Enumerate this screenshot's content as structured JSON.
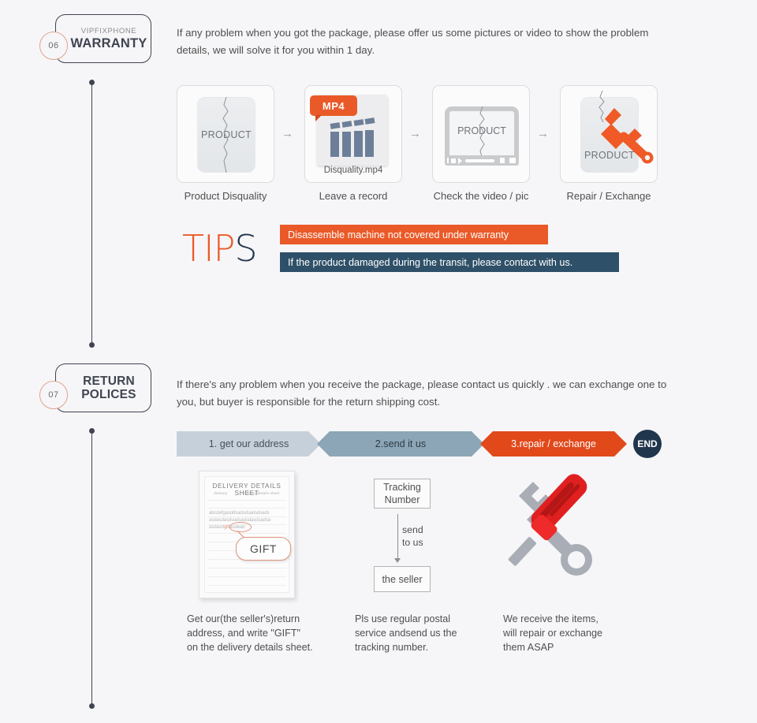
{
  "theme": {
    "background": "#f6f6f8",
    "accent_orange": "#ea5a28",
    "accent_red": "#e1491b",
    "navy": "#22374e",
    "steel": "#8ca6b8",
    "light_steel": "#c5d0da",
    "line": "#3f4450",
    "number_ring": "#e0a48e"
  },
  "sections": [
    {
      "number": "06",
      "brand": "VIPFIXPHONE",
      "title": "WARRANTY",
      "paragraph": "If any problem when you got the package, please offer us some pictures or video to show the problem details, we will solve it for you within 1 day."
    },
    {
      "number": "07",
      "brand": "",
      "title_line1": "RETURN",
      "title_line2": "POLICES",
      "paragraph": "If there's any problem when you receive the package, please contact us quickly . we can exchange one to you, but buyer is responsible for the return shipping cost."
    }
  ],
  "warranty_flow": {
    "steps": [
      {
        "caption": "Product Disquality",
        "product_label": "PRODUCT"
      },
      {
        "caption": "Leave a record",
        "badge": "MP4",
        "filename": "Disquality.mp4"
      },
      {
        "caption": "Check the video / pic",
        "product_label": "PRODUCT"
      },
      {
        "caption": "Repair / Exchange",
        "product_label": "PRODUCT"
      }
    ],
    "arrow_glyph": "→"
  },
  "tips": {
    "word_part1": "TIP",
    "word_part2": "S",
    "bars": [
      {
        "text": "Disassemble machine not covered under warranty",
        "color": "#ea5a28"
      },
      {
        "text": "If the product damaged during the transit, please contact with us.",
        "color": "#2e5068"
      }
    ]
  },
  "return_steps": {
    "chevrons": [
      {
        "label": "1. get our address",
        "color": "#c5d0da"
      },
      {
        "label": "2.send it us",
        "color": "#8ca6b8"
      },
      {
        "label": "3.repair / exchange",
        "color": "#e1491b"
      }
    ],
    "end_label": "END"
  },
  "delivery_sheet": {
    "title": "DELIVERY DETAILS SHEET",
    "sub_left": "delivery",
    "sub_right": "delivery details sheet",
    "scribble_lines": [
      "abcdefgasddsadsdsadsdsads",
      "asdasdasdsadsadsdasdsadsa",
      "asdasd"
    ],
    "scribble_highlight": "gift",
    "scribble_tail": "asdead",
    "callout": "GIFT"
  },
  "tracking": {
    "box_top_line1": "Tracking",
    "box_top_line2": "Number",
    "arrow_label_line1": "send",
    "arrow_label_line2": "to us",
    "box_bottom": "the seller"
  },
  "bottom_captions": [
    {
      "line1": "Get our(the seller's)return",
      "line2": "address, and write \"GIFT\"",
      "line3": "on the delivery details sheet."
    },
    {
      "line1": "Pls use regular postal",
      "line2": "service andsend us the",
      "line3": "tracking number."
    },
    {
      "line1": "We receive the items,",
      "line2": "will repair or exchange",
      "line3": "them ASAP"
    }
  ]
}
